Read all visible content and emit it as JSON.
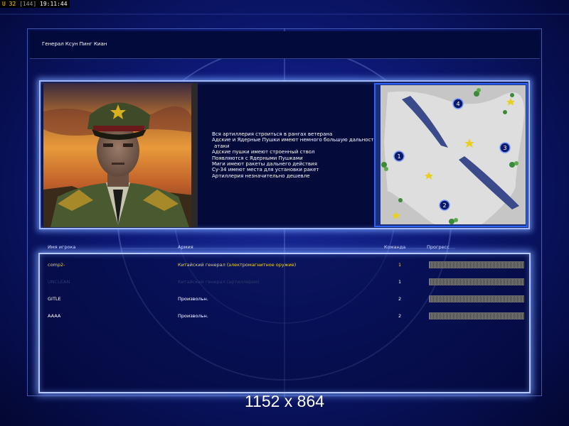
{
  "hud": {
    "fps_label": "U 32",
    "frame_count": "[144]",
    "clock": "19:11:44"
  },
  "general_title": "Генерал Ксун Пинг Киан",
  "description": [
    "Вся артиллерия строиться в рангах ветерана",
    "Адские и Ядерные Пушки имеют немного большую дальность",
    "атаки",
    "Адские пушки имеют строенный ствол",
    "Появляются с Ядерными Пушками",
    "Миги имеют ракеты дальнего действия",
    "Су-34 имеют места для установки ракет",
    "Артиллерия незначительно дешевле"
  ],
  "map": {
    "start_positions": [
      "1",
      "2",
      "3",
      "4"
    ]
  },
  "columns": {
    "player": "Имя игрока",
    "army": "Армия",
    "team": "Команда",
    "progress": "Прогресс"
  },
  "players": [
    {
      "name": "comp2-",
      "army": "Китайский генерал (электромагнитное оружие)",
      "team": "1",
      "progress": 1.0
    },
    {
      "name": "UNCLEAN",
      "army": "Китайский генерал (артиллерия)",
      "team": "1",
      "progress": 1.0
    },
    {
      "name": "GITLE",
      "army": "Произвольн.",
      "team": "2",
      "progress": 1.0
    },
    {
      "name": "AAAA",
      "army": "Произвольн.",
      "team": "2",
      "progress": 1.0
    }
  ],
  "resolution_label": "1152 x 864"
}
